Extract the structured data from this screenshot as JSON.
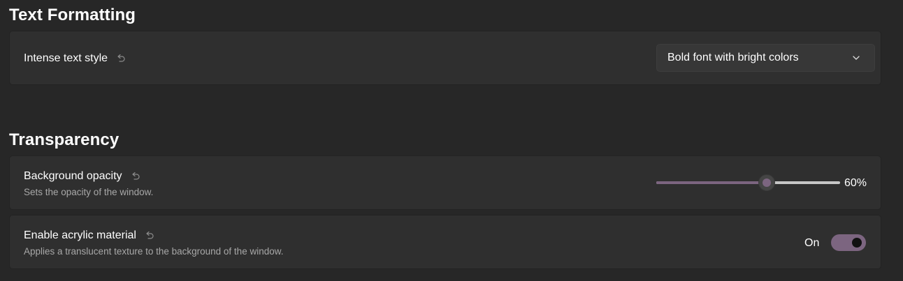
{
  "sections": {
    "text_formatting": {
      "title": "Text Formatting",
      "intense_text_style": {
        "label": "Intense text style",
        "selected_value": "Bold font with bright colors"
      }
    },
    "transparency": {
      "title": "Transparency",
      "background_opacity": {
        "label": "Background opacity",
        "description": "Sets the opacity of the window.",
        "value_percent": 60,
        "value_text": "60%"
      },
      "acrylic": {
        "label": "Enable acrylic material",
        "description": "Applies a translucent texture to the background of the window.",
        "state_text": "On",
        "enabled": true
      }
    }
  },
  "icons": {
    "reset": "reset-icon",
    "dropdown": "chevron-down-icon"
  },
  "colors": {
    "background": "#272727",
    "card": "#2f2f2f",
    "accent": "#7c6580",
    "secondary_text": "#a8a8a8"
  }
}
